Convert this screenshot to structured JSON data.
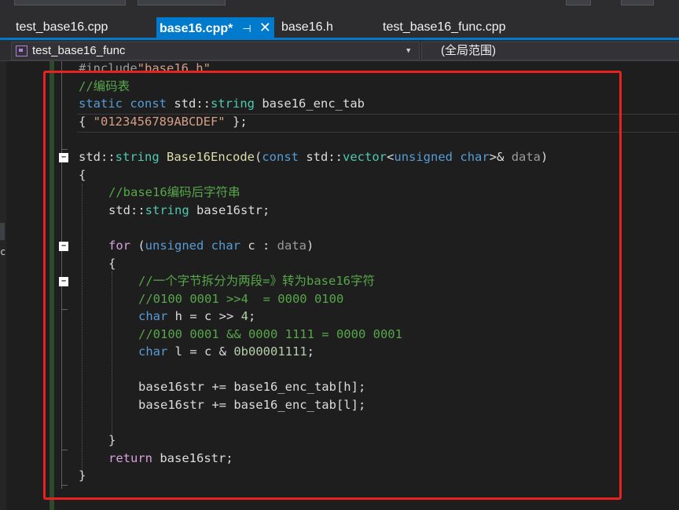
{
  "tabs": [
    {
      "label": "test_base16.cpp",
      "active": false
    },
    {
      "label": "base16.cpp*",
      "active": true,
      "pin_icon": "pin-icon",
      "close_icon": "close-icon"
    },
    {
      "label": "base16.h",
      "active": false
    },
    {
      "label": "test_base16_func.cpp",
      "active": false
    }
  ],
  "navbar": {
    "function_scope": "test_base16_func",
    "global_scope": "(全局范围)",
    "dropdown_icon": "chevron-down-icon"
  },
  "colors": {
    "accent": "#007acc",
    "editor_bg": "#1e1e1e",
    "highlight_box": "#e8231f",
    "keyword": "#569cd6",
    "type": "#4ec9b0",
    "string": "#d69d85",
    "comment": "#57a64a",
    "function": "#dcdcaa"
  },
  "code": {
    "l0": {
      "a": "#include",
      "b": "\"base16.h\""
    },
    "l1": {
      "a": "//编码表"
    },
    "l2": {
      "a": "static",
      "b": " ",
      "c": "const",
      "d": " std::",
      "e": "string",
      "f": " base16_enc_tab"
    },
    "l3": {
      "a": "{ ",
      "b": "\"0123456789ABCDEF\"",
      "c": " };"
    },
    "l5": {
      "a": "std::",
      "b": "string",
      "c": " ",
      "d": "Base16Encode",
      "e": "(",
      "f": "const",
      "g": " std::",
      "h": "vector",
      "i": "<",
      "j": "unsigned",
      "k": " ",
      "l": "char",
      "m": ">& ",
      "n": "data",
      "o": ")"
    },
    "l6": {
      "a": "{"
    },
    "l7": {
      "a": "//base16编码后字符串"
    },
    "l8": {
      "a": "std::",
      "b": "string",
      "c": " base16str;"
    },
    "l10": {
      "a": "for",
      "b": " (",
      "c": "unsigned",
      "d": " ",
      "e": "char",
      "f": " c : ",
      "g": "data",
      "h": ")"
    },
    "l11": {
      "a": "{"
    },
    "l12": {
      "a": "//一个字节拆分为两段=》转为base16字符"
    },
    "l13": {
      "a": "//0100 0001 >>4  = 0000 0100"
    },
    "l14": {
      "a": "char",
      "b": " h = c >> ",
      "c": "4",
      "d": ";"
    },
    "l15": {
      "a": "//0100 0001 && 0000 1111 = 0000 0001"
    },
    "l16": {
      "a": "char",
      "b": " l = c & ",
      "c": "0b00001111",
      "d": ";"
    },
    "l18": {
      "a": "base16str += base16_enc_tab[h];"
    },
    "l19": {
      "a": "base16str += base16_enc_tab[l];"
    },
    "l21": {
      "a": "}"
    },
    "l22": {
      "a": "return",
      "b": " base16str;"
    },
    "l23": {
      "a": "}"
    }
  },
  "fold_icons": [
    "collapse-icon",
    "collapse-icon",
    "collapse-icon"
  ]
}
